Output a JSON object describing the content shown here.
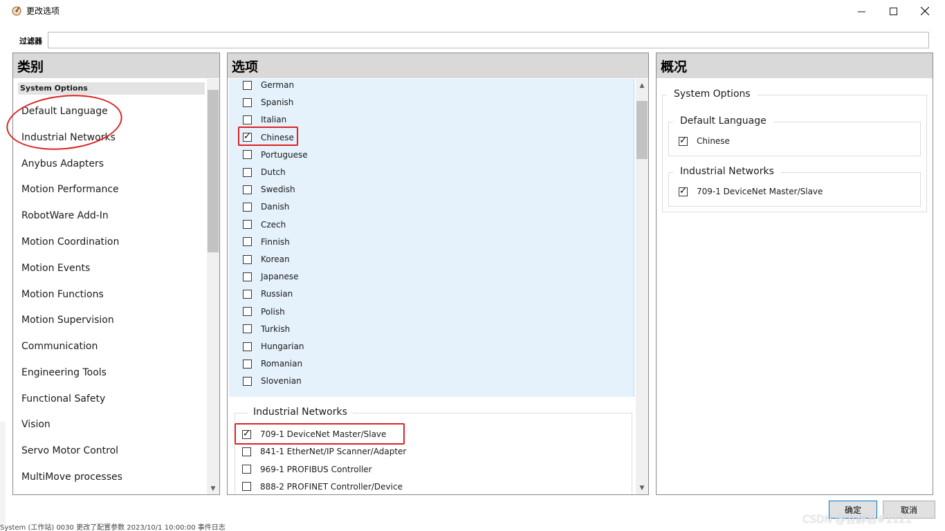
{
  "window": {
    "title": "更改选项"
  },
  "filter": {
    "label": "过滤器",
    "value": ""
  },
  "categories": {
    "header": "类别",
    "section": "System Options",
    "items": [
      "Default Language",
      "Industrial Networks",
      "Anybus Adapters",
      "Motion Performance",
      "RobotWare Add-In",
      "Motion Coordination",
      "Motion Events",
      "Motion Functions",
      "Motion Supervision",
      "Communication",
      "Engineering Tools",
      "Functional Safety",
      "Vision",
      "Servo Motor Control",
      "MultiMove processes"
    ]
  },
  "options": {
    "header": "选项",
    "languages": [
      {
        "label": "German",
        "checked": false
      },
      {
        "label": "Spanish",
        "checked": false
      },
      {
        "label": "Italian",
        "checked": false
      },
      {
        "label": "Chinese",
        "checked": true
      },
      {
        "label": "Portuguese",
        "checked": false
      },
      {
        "label": "Dutch",
        "checked": false
      },
      {
        "label": "Swedish",
        "checked": false
      },
      {
        "label": "Danish",
        "checked": false
      },
      {
        "label": "Czech",
        "checked": false
      },
      {
        "label": "Finnish",
        "checked": false
      },
      {
        "label": "Korean",
        "checked": false
      },
      {
        "label": "Japanese",
        "checked": false
      },
      {
        "label": "Russian",
        "checked": false
      },
      {
        "label": "Polish",
        "checked": false
      },
      {
        "label": "Turkish",
        "checked": false
      },
      {
        "label": "Hungarian",
        "checked": false
      },
      {
        "label": "Romanian",
        "checked": false
      },
      {
        "label": "Slovenian",
        "checked": false
      }
    ],
    "networks_title": "Industrial Networks",
    "networks": [
      {
        "label": "709-1 DeviceNet Master/Slave",
        "checked": true
      },
      {
        "label": "841-1 EtherNet/IP Scanner/Adapter",
        "checked": false
      },
      {
        "label": "969-1 PROFIBUS Controller",
        "checked": false
      },
      {
        "label": "888-2 PROFINET Controller/Device",
        "checked": false
      }
    ]
  },
  "summary": {
    "header": "概况",
    "group_title": "System Options",
    "language_title": "Default Language",
    "language_value": "Chinese",
    "networks_title": "Industrial Networks",
    "networks_value": "709-1 DeviceNet Master/Slave"
  },
  "buttons": {
    "ok": "确定",
    "cancel": "取消"
  },
  "watermark": "CSDN @吾醉君#1121",
  "background_strip": "System (工作站)  0030   更改了配置参数                                     2023/10/1 10:00:00        事件日志"
}
